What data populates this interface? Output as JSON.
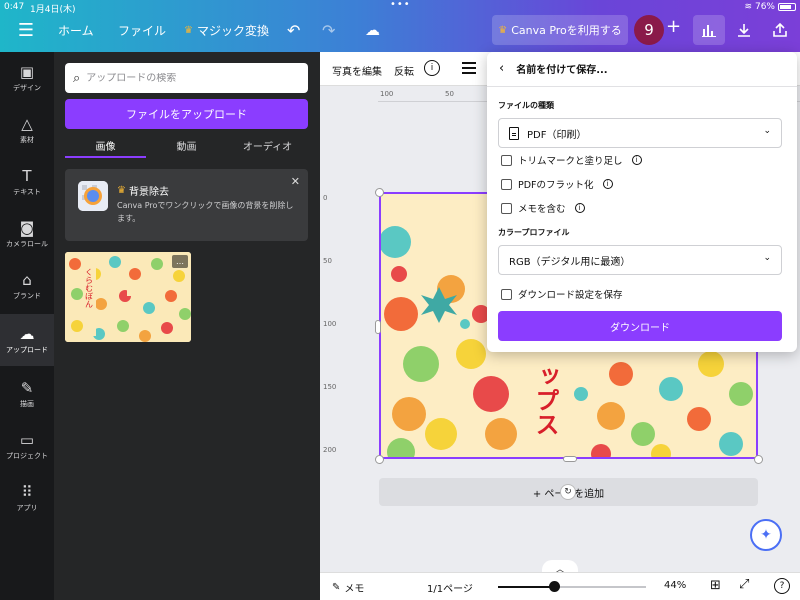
{
  "status_bar": {
    "time": "0:47",
    "date": "1月4日(木)",
    "dots": "•••",
    "battery": "76%"
  },
  "top_bar": {
    "menu_icon": "hamburger-icon",
    "home_label": "ホーム",
    "file_label": "ファイル",
    "magic_label": "マジック変換",
    "pro_label": "Canva Proを利用する",
    "avatar_text": "9",
    "plus_label": "+",
    "accent": "#8b3dff"
  },
  "rail": {
    "items": [
      {
        "label": "デザイン",
        "icon": "design-icon"
      },
      {
        "label": "素材",
        "icon": "elements-icon"
      },
      {
        "label": "テキスト",
        "icon": "text-icon"
      },
      {
        "label": "カメラロール",
        "icon": "camera-icon"
      },
      {
        "label": "ブランド",
        "icon": "brand-icon"
      },
      {
        "label": "アップロード",
        "icon": "upload-icon"
      },
      {
        "label": "描画",
        "icon": "draw-icon"
      },
      {
        "label": "プロジェクト",
        "icon": "folder-icon"
      },
      {
        "label": "アプリ",
        "icon": "apps-icon"
      }
    ]
  },
  "panel": {
    "search_placeholder": "アップロードの検索",
    "upload_label": "ファイルをアップロード",
    "tabs": [
      {
        "label": "画像"
      },
      {
        "label": "動画"
      },
      {
        "label": "オーディオ"
      }
    ],
    "bg_remove": {
      "title": "背景除去",
      "desc": "Canva Proでワンクリックで画像の背景を削除します。"
    },
    "thumb_more": "…"
  },
  "editor": {
    "ctx_edit": "写真を編集",
    "ctx_flip": "反転",
    "ctx_info": "i",
    "ruler_h": [
      "100",
      "50"
    ],
    "ruler_v": [
      "0",
      "50",
      "100",
      "150",
      "200"
    ],
    "canvas_text": "ップス",
    "add_page": "+ ページを追加",
    "rotate_icon": "↻",
    "magic_icon": "✦"
  },
  "bottom_bar": {
    "notes_label": "メモ",
    "page_label": "1/1ページ",
    "zoom_label": "44%",
    "zoom_fraction": 0.38,
    "help_label": "?"
  },
  "save_dialog": {
    "title": "名前を付けて保存...",
    "file_type_label": "ファイルの種類",
    "file_type_value": "PDF（印刷）",
    "options": [
      {
        "label": "トリムマークと塗り足し",
        "checked": false
      },
      {
        "label": "PDFのフラット化",
        "checked": false
      },
      {
        "label": "メモを含む",
        "checked": false
      }
    ],
    "color_profile_label": "カラープロファイル",
    "color_profile_value": "RGB（デジタル用に最適）",
    "save_settings_label": "ダウンロード設定を保存",
    "download_label": "ダウンロード"
  }
}
